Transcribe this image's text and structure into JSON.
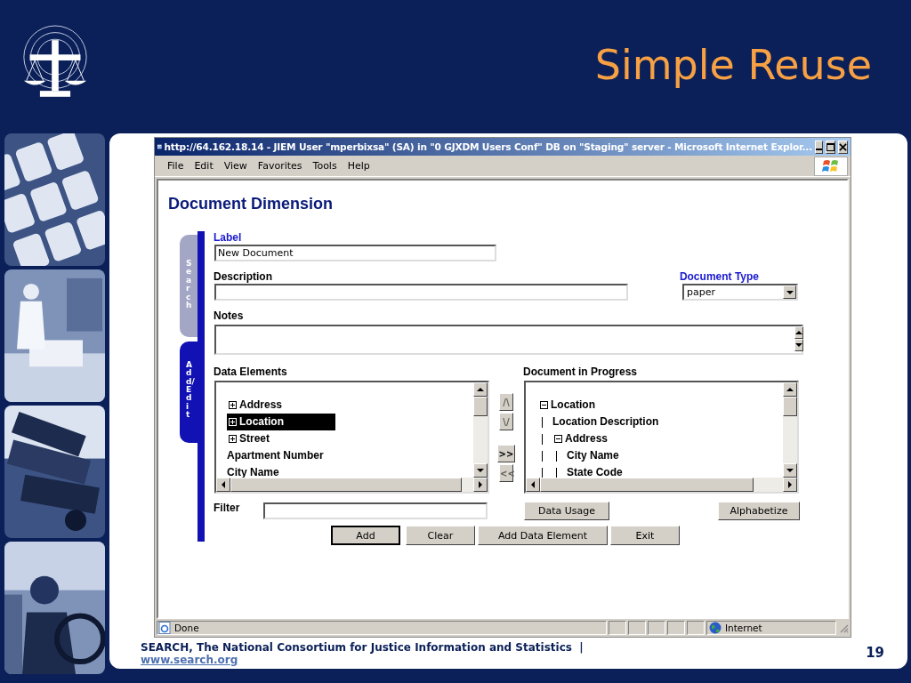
{
  "slide": {
    "title": "Simple Reuse",
    "footer": "SEARCH, The National Consortium for Justice Information and Statistics  |",
    "footer_link": "www.search.org",
    "page_number": "19"
  },
  "browser": {
    "title": "http://64.162.18.14 - JIEM User \"mperbixsa\" (SA) in \"0 GJXDM Users Conf\" DB on \"Staging\" server - Microsoft Internet Explor...",
    "menu": [
      "File",
      "Edit",
      "View",
      "Favorites",
      "Tools",
      "Help"
    ],
    "status": "Done",
    "zone": "Internet"
  },
  "page": {
    "heading": "Document Dimension",
    "side_tabs": [
      {
        "label": "Search",
        "selected": false
      },
      {
        "label": "Add/Edit",
        "selected": true
      }
    ],
    "label_field": {
      "label": "Label",
      "value": "New Document"
    },
    "description_field": {
      "label": "Description"
    },
    "document_type": {
      "label": "Document Type",
      "value": "paper"
    },
    "notes_field": {
      "label": "Notes"
    },
    "data_elements": {
      "title": "Data Elements",
      "items": [
        {
          "text": "Address",
          "kind": "group",
          "expanded": false,
          "selected": false
        },
        {
          "text": "Location",
          "kind": "group",
          "expanded": false,
          "selected": true
        },
        {
          "text": "Street",
          "kind": "group",
          "expanded": false,
          "selected": false
        },
        {
          "text": "Apartment Number",
          "kind": "leaf",
          "selected": false
        },
        {
          "text": "City Name",
          "kind": "leaf",
          "selected": false
        }
      ]
    },
    "move_buttons": [
      {
        "label": "/\\",
        "disabled": true
      },
      {
        "label": "\\/",
        "disabled": true
      },
      {
        "label": ">>",
        "disabled": false
      },
      {
        "label": "<<",
        "disabled": true
      }
    ],
    "document_in_progress": {
      "title": "Document in Progress",
      "tree": [
        {
          "text": "Location",
          "expanded": true,
          "children": [
            {
              "text": "Location Description"
            },
            {
              "text": "Address",
              "expanded": true,
              "children": [
                {
                  "text": "City Name"
                },
                {
                  "text": "State Code"
                }
              ]
            }
          ]
        }
      ]
    },
    "filter": {
      "label": "Filter"
    },
    "data_usage_button": "Data Usage",
    "alphabetize_button": "Alphabetize",
    "buttons": [
      {
        "label": "Add",
        "default": true
      },
      {
        "label": "Clear",
        "default": false
      },
      {
        "label": "Add Data Element",
        "default": false
      },
      {
        "label": "Exit",
        "default": false
      }
    ]
  }
}
